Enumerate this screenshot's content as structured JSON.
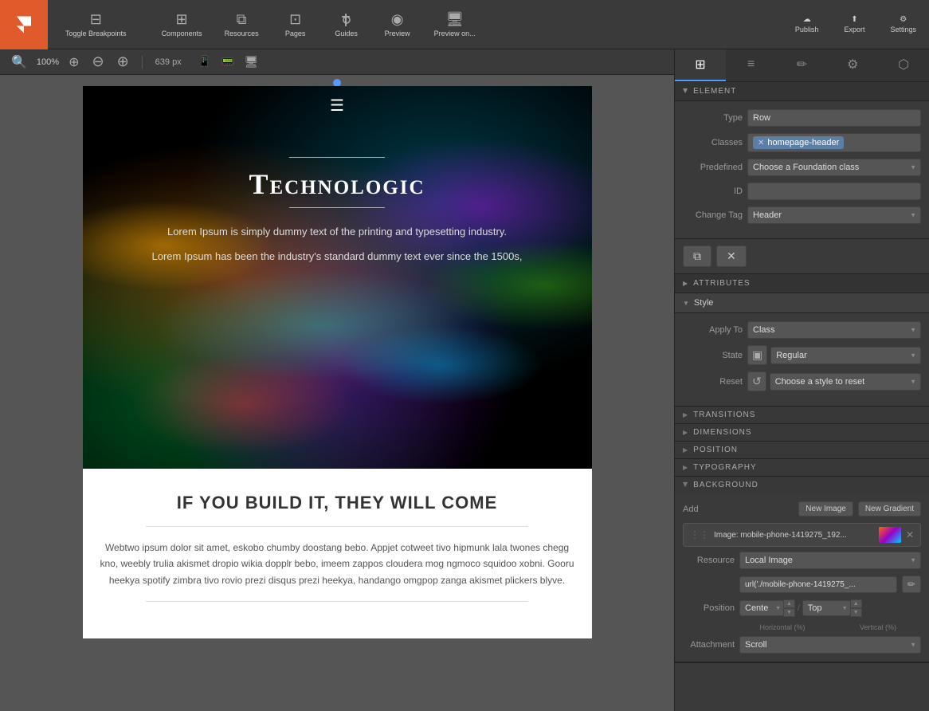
{
  "toolbar": {
    "logo_icon": "framer-icon",
    "toggle_breakpoints": "Toggle Breakpoints",
    "components": "Components",
    "resources": "Resources",
    "pages": "Pages",
    "guides": "Guides",
    "preview": "Preview",
    "preview_on": "Preview on...",
    "publish": "Publish",
    "export": "Export",
    "settings": "Settings"
  },
  "canvas": {
    "zoom": "100%",
    "width": "639 px",
    "devices": [
      "desktop-small",
      "tablet",
      "desktop-large"
    ]
  },
  "hero": {
    "menu_icon": "☰",
    "title": "Technologic",
    "subtitle": "Lorem Ipsum is simply dummy text of the printing and typesetting industry.",
    "text": "Lorem Ipsum has been the industry's standard dummy text ever since the 1500s,"
  },
  "content": {
    "heading": "IF YOU BUILD IT, THEY WILL COME",
    "body": "Webtwo ipsum dolor sit amet, eskobo chumby doostang bebo. Appjet cotweet tivo hipmunk lala twones chegg kno, weebly trulia akismet dropio wikia dopplr bebo, imeem zappos cloudera mog ngmoco squidoo xobni. Gooru heekya spotify zimbra tivo rovio prezi disqus prezi heekya, handango omgpop zanga akismet plickers blyve."
  },
  "panel": {
    "tabs": [
      {
        "label": "⊞",
        "icon": "grid-icon",
        "active": true
      },
      {
        "label": "≡",
        "icon": "list-icon",
        "active": false
      },
      {
        "label": "✏",
        "icon": "edit-icon",
        "active": false
      },
      {
        "label": "⚙",
        "icon": "gear-icon",
        "active": false
      },
      {
        "label": "⬡",
        "icon": "hex-icon",
        "active": false
      }
    ],
    "element_section": {
      "label": "Element",
      "type_label": "Type",
      "type_value": "Row",
      "classes_label": "Classes",
      "class_tag": "homepage-header",
      "predefined_label": "Predefined",
      "predefined_placeholder": "Choose a Foundation class",
      "id_label": "ID",
      "id_value": "",
      "change_tag_label": "Change Tag",
      "change_tag_value": "Header",
      "attributes_label": "ATTRIBUTES"
    },
    "style_section": {
      "label": "Style",
      "apply_to_label": "Apply To",
      "apply_to_value": "Class",
      "state_label": "State",
      "state_icon": "state-icon",
      "state_value": "Regular",
      "reset_label": "Reset",
      "reset_icon": "reset-icon",
      "reset_placeholder": "Choose a style to reset",
      "subsections": [
        {
          "label": "TRANSITIONS",
          "expanded": false
        },
        {
          "label": "DIMENSIONS",
          "expanded": false
        },
        {
          "label": "POSITION",
          "expanded": false
        },
        {
          "label": "TYPOGRAPHY",
          "expanded": false
        },
        {
          "label": "BACKGROUND",
          "expanded": true
        }
      ]
    },
    "background": {
      "add_label": "Add",
      "new_image_btn": "New Image",
      "new_gradient_btn": "New Gradient",
      "image_item_label": "Image: mobile-phone-1419275_192...",
      "resource_label": "Resource",
      "resource_value": "Local Image",
      "url_value": "url('./mobile-phone-1419275_...",
      "position_label": "Position",
      "horizontal_label": "Horizontal (%)",
      "horizontal_value": "Cente",
      "vertical_label": "Vertical (%)",
      "vertical_value": "Top",
      "attachment_label": "Attachment",
      "attachment_value": "Scroll"
    }
  }
}
